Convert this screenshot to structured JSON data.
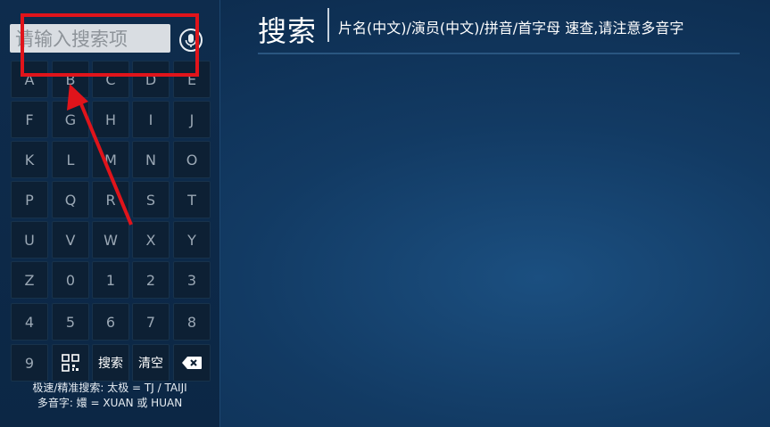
{
  "sidebar": {
    "search_placeholder": "请输入搜索项",
    "keys": [
      "A",
      "B",
      "C",
      "D",
      "E",
      "F",
      "G",
      "H",
      "I",
      "J",
      "K",
      "L",
      "M",
      "N",
      "O",
      "P",
      "Q",
      "R",
      "S",
      "T",
      "U",
      "V",
      "W",
      "X",
      "Y",
      "Z",
      "0",
      "1",
      "2",
      "3",
      "4",
      "5",
      "6",
      "7",
      "8",
      "9"
    ],
    "search_key_label": "搜索",
    "clear_key_label": "清空",
    "hint_line1": "极速/精准搜索: 太极 = TJ / TAIJI",
    "hint_line2": "多音字: 嬛 = XUAN 或 HUAN"
  },
  "main": {
    "title": "搜索",
    "subtitle": "片名(中文)/演员(中文)/拼音/首字母 速查,请注意多音字"
  },
  "colors": {
    "highlight": "#e0141b",
    "background": "#123a63"
  },
  "icons": {
    "mic": "microphone-icon",
    "qr": "qr-code-icon",
    "backspace": "backspace-icon"
  }
}
